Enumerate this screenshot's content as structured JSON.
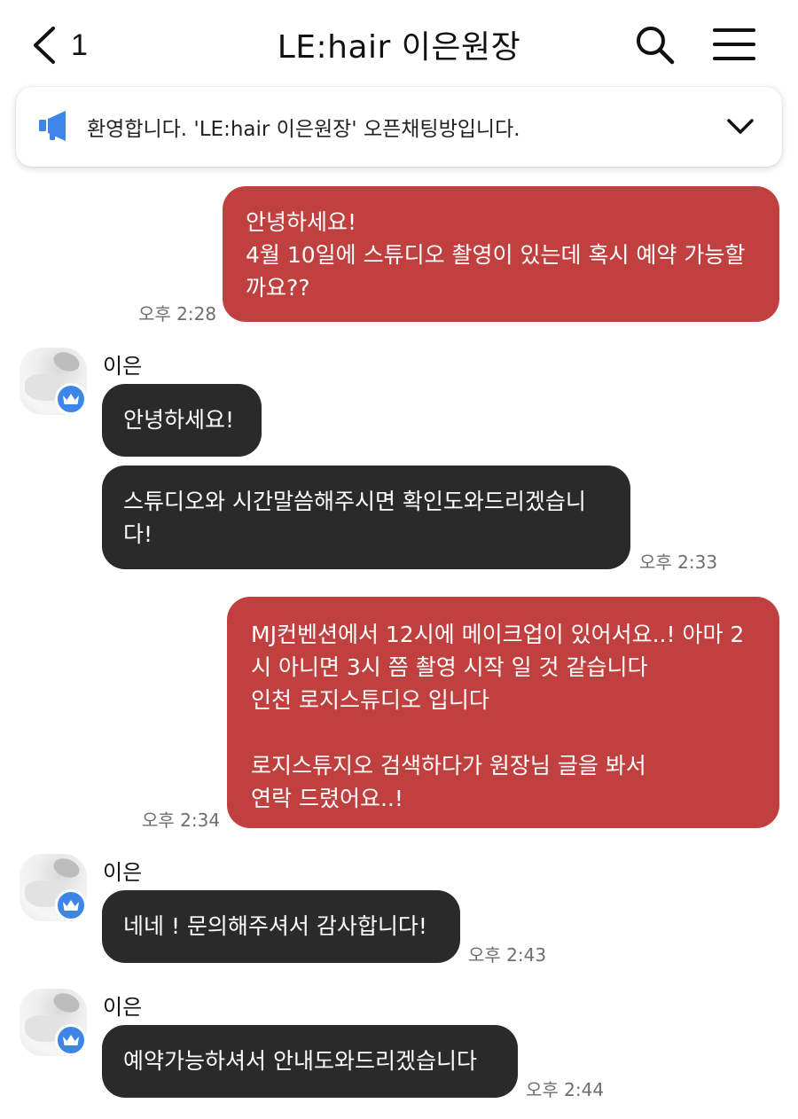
{
  "header": {
    "back_count": "1",
    "title": "LE:hair 이은원장"
  },
  "notice": {
    "text": "환영합니다. 'LE:hair 이은원장' 오픈채팅방입니다."
  },
  "colors": {
    "my_bubble": "#c0403f",
    "other_bubble": "#2a2a2a",
    "badge": "#3d86e8"
  },
  "icons": [
    "chevron-left-icon",
    "search-icon",
    "hamburger-menu-icon",
    "megaphone-icon",
    "chevron-down-icon",
    "crown-icon"
  ],
  "messages": [
    {
      "from": "me",
      "text": "안녕하세요!\n4월 10일에 스튜디오 촬영이 있는데 혹시 예약 가능할\n까요??",
      "time": "오후 2:28"
    },
    {
      "from": "other",
      "sender": "이은",
      "text": "안녕하세요!"
    },
    {
      "from": "other",
      "text": "스튜디오와 시간말씀해주시면 확인도와드리겠습니\n다!",
      "time": "오후 2:33"
    },
    {
      "from": "me",
      "text": "MJ컨벤션에서 12시에 메이크업이 있어서요..! 아마 2\n시 아니면 3시 쯤 촬영 시작 일 것 같습니다\n인천 로지스튜디오 입니다\n\n로지스튜지오 검색하다가 원장님 글을 봐서\n연락 드렸어요..!",
      "time": "오후 2:34"
    },
    {
      "from": "other",
      "sender": "이은",
      "text": "네네 ! 문의해주셔서 감사합니다!",
      "time": "오후 2:43"
    },
    {
      "from": "other",
      "sender": "이은",
      "text": "예약가능하셔서 안내도와드리겠습니다",
      "time": "오후 2:44"
    }
  ]
}
